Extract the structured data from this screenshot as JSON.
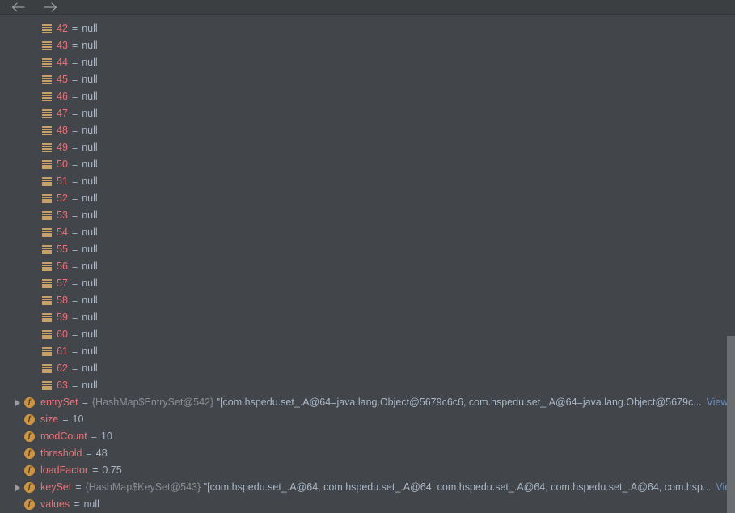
{
  "toolbar": {
    "back_icon": "arrow-left-icon",
    "forward_icon": "arrow-right-icon"
  },
  "tree": {
    "array_entries": [
      {
        "index": "42",
        "value": "null"
      },
      {
        "index": "43",
        "value": "null"
      },
      {
        "index": "44",
        "value": "null"
      },
      {
        "index": "45",
        "value": "null"
      },
      {
        "index": "46",
        "value": "null"
      },
      {
        "index": "47",
        "value": "null"
      },
      {
        "index": "48",
        "value": "null"
      },
      {
        "index": "49",
        "value": "null"
      },
      {
        "index": "50",
        "value": "null"
      },
      {
        "index": "51",
        "value": "null"
      },
      {
        "index": "52",
        "value": "null"
      },
      {
        "index": "53",
        "value": "null"
      },
      {
        "index": "54",
        "value": "null"
      },
      {
        "index": "55",
        "value": "null"
      },
      {
        "index": "56",
        "value": "null"
      },
      {
        "index": "57",
        "value": "null"
      },
      {
        "index": "58",
        "value": "null"
      },
      {
        "index": "59",
        "value": "null"
      },
      {
        "index": "60",
        "value": "null"
      },
      {
        "index": "61",
        "value": "null"
      },
      {
        "index": "62",
        "value": "null"
      },
      {
        "index": "63",
        "value": "null"
      }
    ],
    "fields": [
      {
        "name": "entrySet",
        "type": "{HashMap$EntrySet@542}",
        "value": "\"[com.hspedu.set_.A@64=java.lang.Object@5679c6c6, com.hspedu.set_.A@64=java.lang.Object@5679c...",
        "view_label": "View",
        "expandable": true
      },
      {
        "name": "size",
        "value": "10",
        "expandable": false
      },
      {
        "name": "modCount",
        "value": "10",
        "expandable": false
      },
      {
        "name": "threshold",
        "value": "48",
        "expandable": false
      },
      {
        "name": "loadFactor",
        "value": "0.75",
        "expandable": false
      },
      {
        "name": "keySet",
        "type": "{HashMap$KeySet@543}",
        "value": "\"[com.hspedu.set_.A@64, com.hspedu.set_.A@64, com.hspedu.set_.A@64, com.hspedu.set_.A@64, com.hsp...",
        "view_label": "View",
        "expandable": true
      },
      {
        "name": "values",
        "value": "null",
        "expandable": false
      }
    ],
    "equals_sign": "="
  },
  "colors": {
    "background": "#42454a",
    "toolbar": "#3c3f41",
    "field_name": "#e8737a",
    "value_text": "#a9b7c6",
    "type_text": "#8a8f94",
    "link": "#6d8fbf",
    "icon_orange": "#cd9443",
    "array_bar": "#c8a06a",
    "scrollbar_thumb": "#6b6e70"
  }
}
